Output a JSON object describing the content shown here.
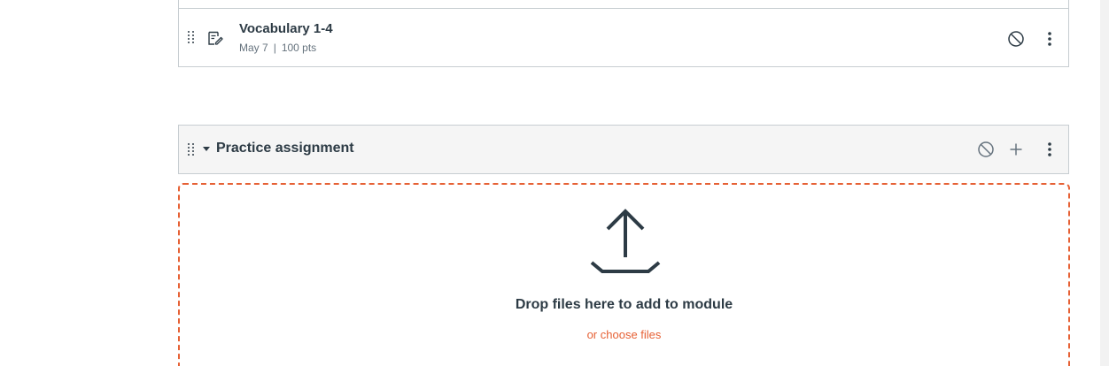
{
  "module_item": {
    "title": "Vocabulary 1-4",
    "date": "May 7",
    "separator": "|",
    "points": "100 pts",
    "icons": {
      "type": "assignment-icon",
      "publish": "unpublished-icon",
      "menu": "kebab-menu-icon"
    }
  },
  "module": {
    "title": "Practice assignment",
    "icons": {
      "toggle": "caret-down-icon",
      "publish": "unpublished-icon",
      "add": "plus-icon",
      "menu": "kebab-menu-icon"
    }
  },
  "dropzone": {
    "icon": "upload-icon",
    "message": "Drop files here to add to module",
    "choose_files": "or choose files"
  },
  "colors": {
    "text": "#2d3b45",
    "muted": "#66737e",
    "border": "#c7cdd1",
    "header_bg": "#f5f5f5",
    "accent": "#e66135"
  }
}
